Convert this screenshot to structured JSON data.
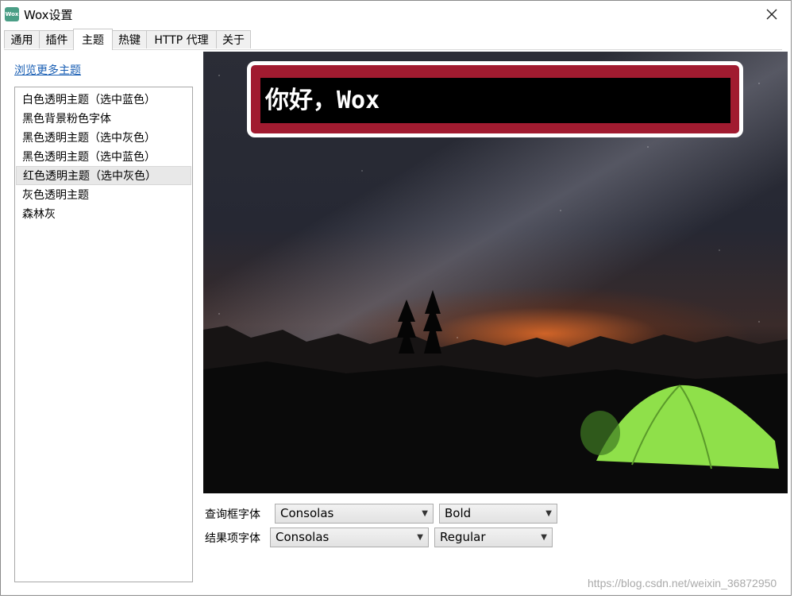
{
  "window": {
    "title": "Wox设置",
    "icon_label": "Wox"
  },
  "tabs": [
    {
      "label": "通用"
    },
    {
      "label": "插件"
    },
    {
      "label": "主题",
      "active": true
    },
    {
      "label": "热键"
    },
    {
      "label": "HTTP 代理"
    },
    {
      "label": "关于"
    }
  ],
  "theme_panel": {
    "more_themes_link": "浏览更多主题",
    "themes": [
      "白色透明主题（选中蓝色）",
      "黑色背景粉色字体",
      "黑色透明主题（选中灰色）",
      "黑色透明主题（选中蓝色）",
      "红色透明主题（选中灰色）",
      "灰色透明主题",
      "森林灰"
    ],
    "selected_theme": "红色透明主题（选中灰色）"
  },
  "preview": {
    "query_text": "你好，Wox"
  },
  "font_settings": {
    "query_label": "查询框字体",
    "query_font": "Consolas",
    "query_weight": "Bold",
    "result_label": "结果项字体",
    "result_font": "Consolas",
    "result_weight": "Regular"
  },
  "watermark": "https://blog.csdn.net/weixin_36872950",
  "colors": {
    "query_frame": "#a11b30",
    "query_input_bg": "#000000",
    "link": "#1a5fb4",
    "tent_green": "#8fe04a"
  },
  "icons": [
    "app-icon",
    "close-icon",
    "chevron-down-icon"
  ]
}
